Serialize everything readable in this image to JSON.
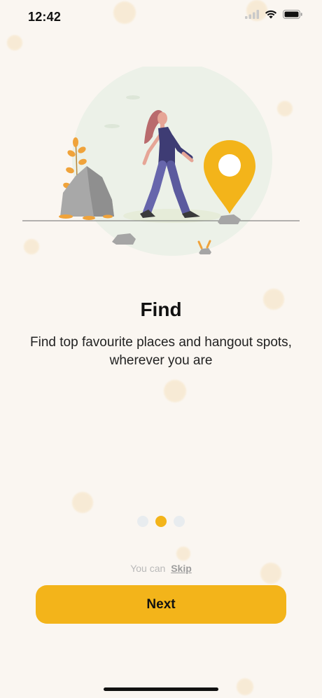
{
  "status_bar": {
    "time": "12:42",
    "icons": [
      "cellular-signal-icon",
      "wifi-icon",
      "battery-icon"
    ]
  },
  "onboarding": {
    "title": "Find",
    "description": "Find top favourite places and hangout spots, wherever you are",
    "current_page": 2,
    "total_pages": 3
  },
  "actions": {
    "skip_prefix": "You can",
    "skip_label": "Skip",
    "next_label": "Next"
  },
  "colors": {
    "accent": "#f3b41a",
    "background": "#faf6f1",
    "inactive_dot": "#e8ecef",
    "text": "#111111"
  }
}
